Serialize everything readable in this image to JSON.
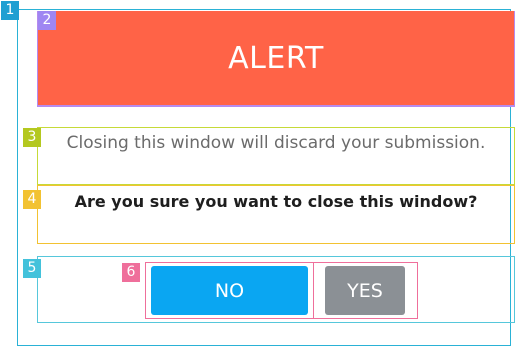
{
  "annotations": {
    "tag_1": "1",
    "tag_2": "2",
    "tag_3": "3",
    "tag_4": "4",
    "tag_5": "5",
    "tag_6": "6"
  },
  "dialog": {
    "title": "ALERT",
    "message": "Closing this window will discard your submission.",
    "question": "Are you sure you want to close this window?",
    "buttons": {
      "no_label": "NO",
      "yes_label": "YES"
    }
  },
  "colors": {
    "alert_header": "#ff6347",
    "primary_button": "#0aa6f2",
    "secondary_button": "#8b9095",
    "message_text": "#6b6b6b",
    "question_text": "#1e1e1e"
  },
  "icons": []
}
